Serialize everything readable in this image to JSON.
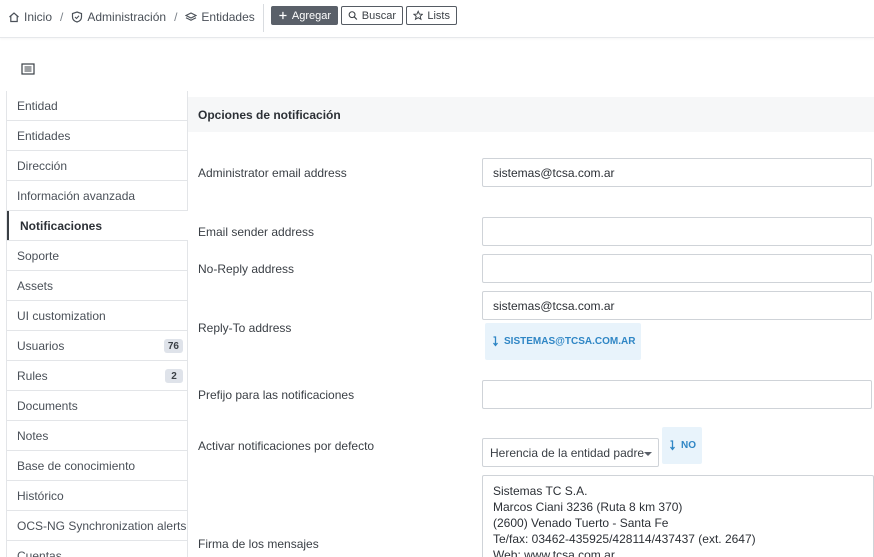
{
  "breadcrumb": {
    "items": [
      {
        "label": "Inicio",
        "icon": "home-icon"
      },
      {
        "label": "Administración",
        "icon": "shield-icon"
      },
      {
        "label": "Entidades",
        "icon": "layers-icon"
      }
    ],
    "separator": "/"
  },
  "toolbar": {
    "add_label": "Agregar",
    "search_label": "Buscar",
    "lists_label": "Lists"
  },
  "sidebar": {
    "items": [
      {
        "label": "Entidad"
      },
      {
        "label": "Entidades"
      },
      {
        "label": "Dirección"
      },
      {
        "label": "Información avanzada"
      },
      {
        "label": "Notificaciones",
        "active": true
      },
      {
        "label": "Soporte"
      },
      {
        "label": "Assets"
      },
      {
        "label": "UI customization"
      },
      {
        "label": "Usuarios",
        "badge": "76"
      },
      {
        "label": "Rules",
        "badge": "2"
      },
      {
        "label": "Documents"
      },
      {
        "label": "Notes"
      },
      {
        "label": "Base de conocimiento"
      },
      {
        "label": "Histórico"
      },
      {
        "label": "OCS-NG Synchronization alerts"
      },
      {
        "label": "Cuentas"
      }
    ]
  },
  "panel": {
    "title": "Opciones de notificación"
  },
  "form": {
    "admin_email": {
      "label": "Administrator email address",
      "value": "sistemas@tcsa.com.ar"
    },
    "sender_email": {
      "label": "Email sender address",
      "value": ""
    },
    "noreply": {
      "label": "No-Reply address",
      "value": ""
    },
    "replyto": {
      "label": "Reply-To address",
      "value": "sistemas@tcsa.com.ar",
      "inherited": "SISTEMAS@TCSA.COM.AR"
    },
    "prefix": {
      "label": "Prefijo para las notificaciones",
      "value": ""
    },
    "activate": {
      "label": "Activar notificaciones por defecto",
      "selected": "Herencia de la entidad padre",
      "inherited": "NO"
    },
    "signature": {
      "label": "Firma de los mensajes",
      "lines": [
        "Sistemas TC S.A.",
        "Marcos Ciani 3236 (Ruta 8 km 370)",
        "(2600) Venado Tuerto - Santa Fe",
        "Te/fax: 03462-435925/428114/437437 (ext. 2647)",
        "Web: www.tcsa.com.ar"
      ]
    }
  },
  "colors": {
    "accent": "#2f86c5",
    "chip_bg": "#e8f3fb",
    "primary_button": "#5a6069"
  }
}
